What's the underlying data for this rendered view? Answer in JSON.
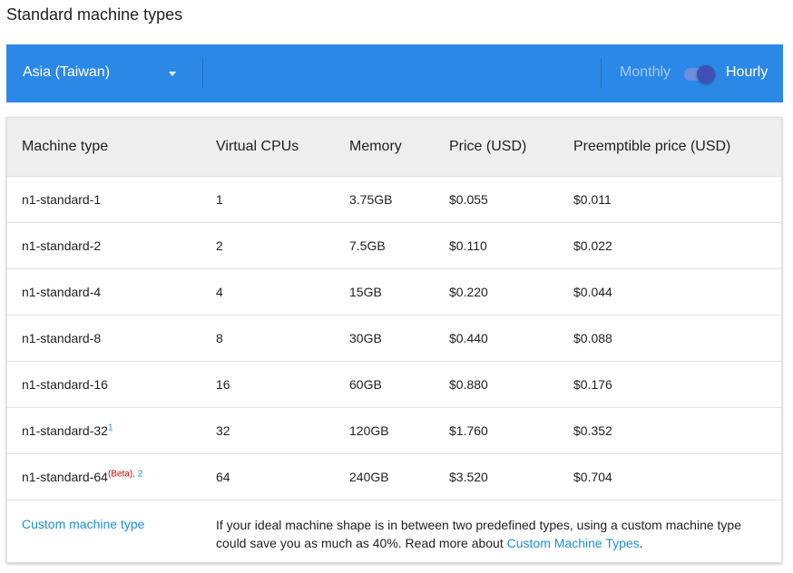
{
  "page": {
    "title": "Standard machine types"
  },
  "toolbar": {
    "region": "Asia (Taiwan)",
    "monthly_label": "Monthly",
    "hourly_label": "Hourly",
    "billing_mode": "Hourly",
    "bar_color": "#2c88e6"
  },
  "table": {
    "headers": [
      "Machine type",
      "Virtual CPUs",
      "Memory",
      "Price (USD)",
      "Preemptible price (USD)"
    ],
    "rows": [
      {
        "machine": "n1-standard-1",
        "note": "",
        "beta": "",
        "cpus": "1",
        "memory": "3.75GB",
        "price": "$0.055",
        "preemptible": "$0.011"
      },
      {
        "machine": "n1-standard-2",
        "note": "",
        "beta": "",
        "cpus": "2",
        "memory": "7.5GB",
        "price": "$0.110",
        "preemptible": "$0.022"
      },
      {
        "machine": "n1-standard-4",
        "note": "",
        "beta": "",
        "cpus": "4",
        "memory": "15GB",
        "price": "$0.220",
        "preemptible": "$0.044"
      },
      {
        "machine": "n1-standard-8",
        "note": "",
        "beta": "",
        "cpus": "8",
        "memory": "30GB",
        "price": "$0.440",
        "preemptible": "$0.088"
      },
      {
        "machine": "n1-standard-16",
        "note": "",
        "beta": "",
        "cpus": "16",
        "memory": "60GB",
        "price": "$0.880",
        "preemptible": "$0.176"
      },
      {
        "machine": "n1-standard-32",
        "note": "1",
        "beta": "",
        "cpus": "32",
        "memory": "120GB",
        "price": "$1.760",
        "preemptible": "$0.352"
      },
      {
        "machine": "n1-standard-64",
        "note": "2",
        "beta": "(Beta)",
        "cpus": "64",
        "memory": "240GB",
        "price": "$3.520",
        "preemptible": "$0.704"
      }
    ],
    "custom": {
      "link_label": "Custom machine type",
      "description": "If your ideal machine shape is in between two predefined types, using a custom machine type could save you as much as 40%. Read more about",
      "more_link": "Custom Machine Types",
      "trailing": "."
    }
  }
}
